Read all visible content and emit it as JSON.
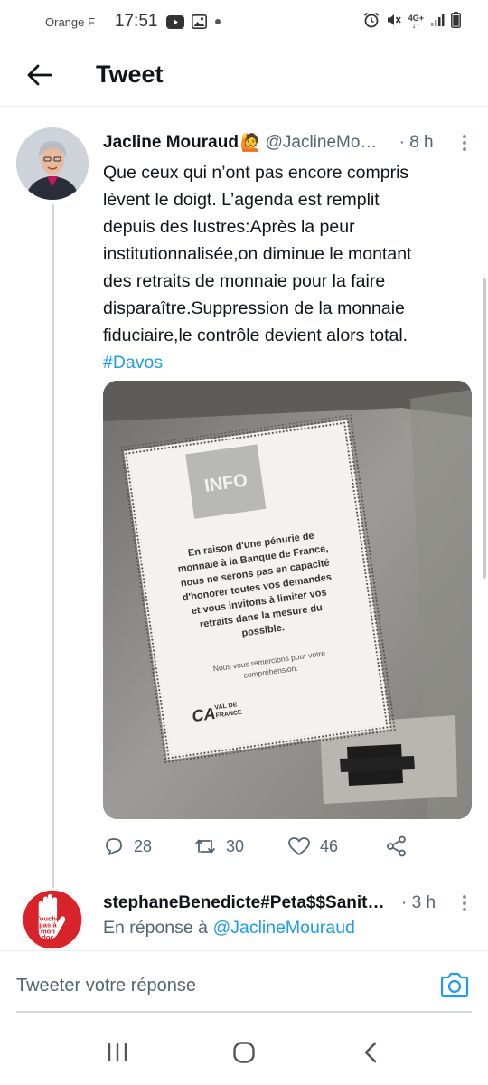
{
  "status_bar": {
    "carrier": "Orange F",
    "time": "17:51",
    "network": "4G+"
  },
  "header": {
    "title": "Tweet",
    "back_icon": "arrow-left-icon"
  },
  "tweet": {
    "author_name": "Jacline Mouraud",
    "author_emoji": "🙋",
    "handle": "@JaclineMouraud",
    "time": "· 8 h",
    "text_lines": [
      "Que ceux qui n’ont pas encore compris",
      "lèvent le doigt. L’agenda est remplit",
      "depuis des lustres:Après la peur",
      "institutionnalisée,on diminue le montant",
      "des retraits de monnaie pour la faire",
      "disparaître.Suppression de la monnaie",
      "fiduciaire,le contrôle devient alors total."
    ],
    "hashtag": "#Davos",
    "media": {
      "info_label": "INFO",
      "notice_lines": [
        "En raison d'une pénurie de",
        "monnaie à la Banque de France,",
        "nous ne serons pas en capacité",
        "d'honorer toutes vos demandes",
        "et vous invitons à limiter vos",
        "retraits dans la mesure du",
        "possible."
      ],
      "thanks_lines": [
        "Nous vous remercions pour votre",
        "compréhension."
      ],
      "logo_text": "CA",
      "logo_sub_1": "VAL DE",
      "logo_sub_2": "FRANCE"
    },
    "actions": {
      "replies": "28",
      "retweets": "30",
      "likes": "46"
    }
  },
  "reply_tweet": {
    "author_name": "stephaneBenedicte#Peta$$Sanitaire",
    "time": "· 3 h",
    "reply_prefix": "En réponse à",
    "reply_mention": "@JaclineMouraud",
    "avatar_text_lines": [
      "Touche",
      "pas à",
      "mon",
      "doc"
    ]
  },
  "reply_bar": {
    "placeholder": "Tweeter votre réponse"
  },
  "colors": {
    "accent": "#1d9bf0",
    "text": "#0f1419",
    "secondary": "#536471",
    "avatar2_red": "#d8232a"
  }
}
